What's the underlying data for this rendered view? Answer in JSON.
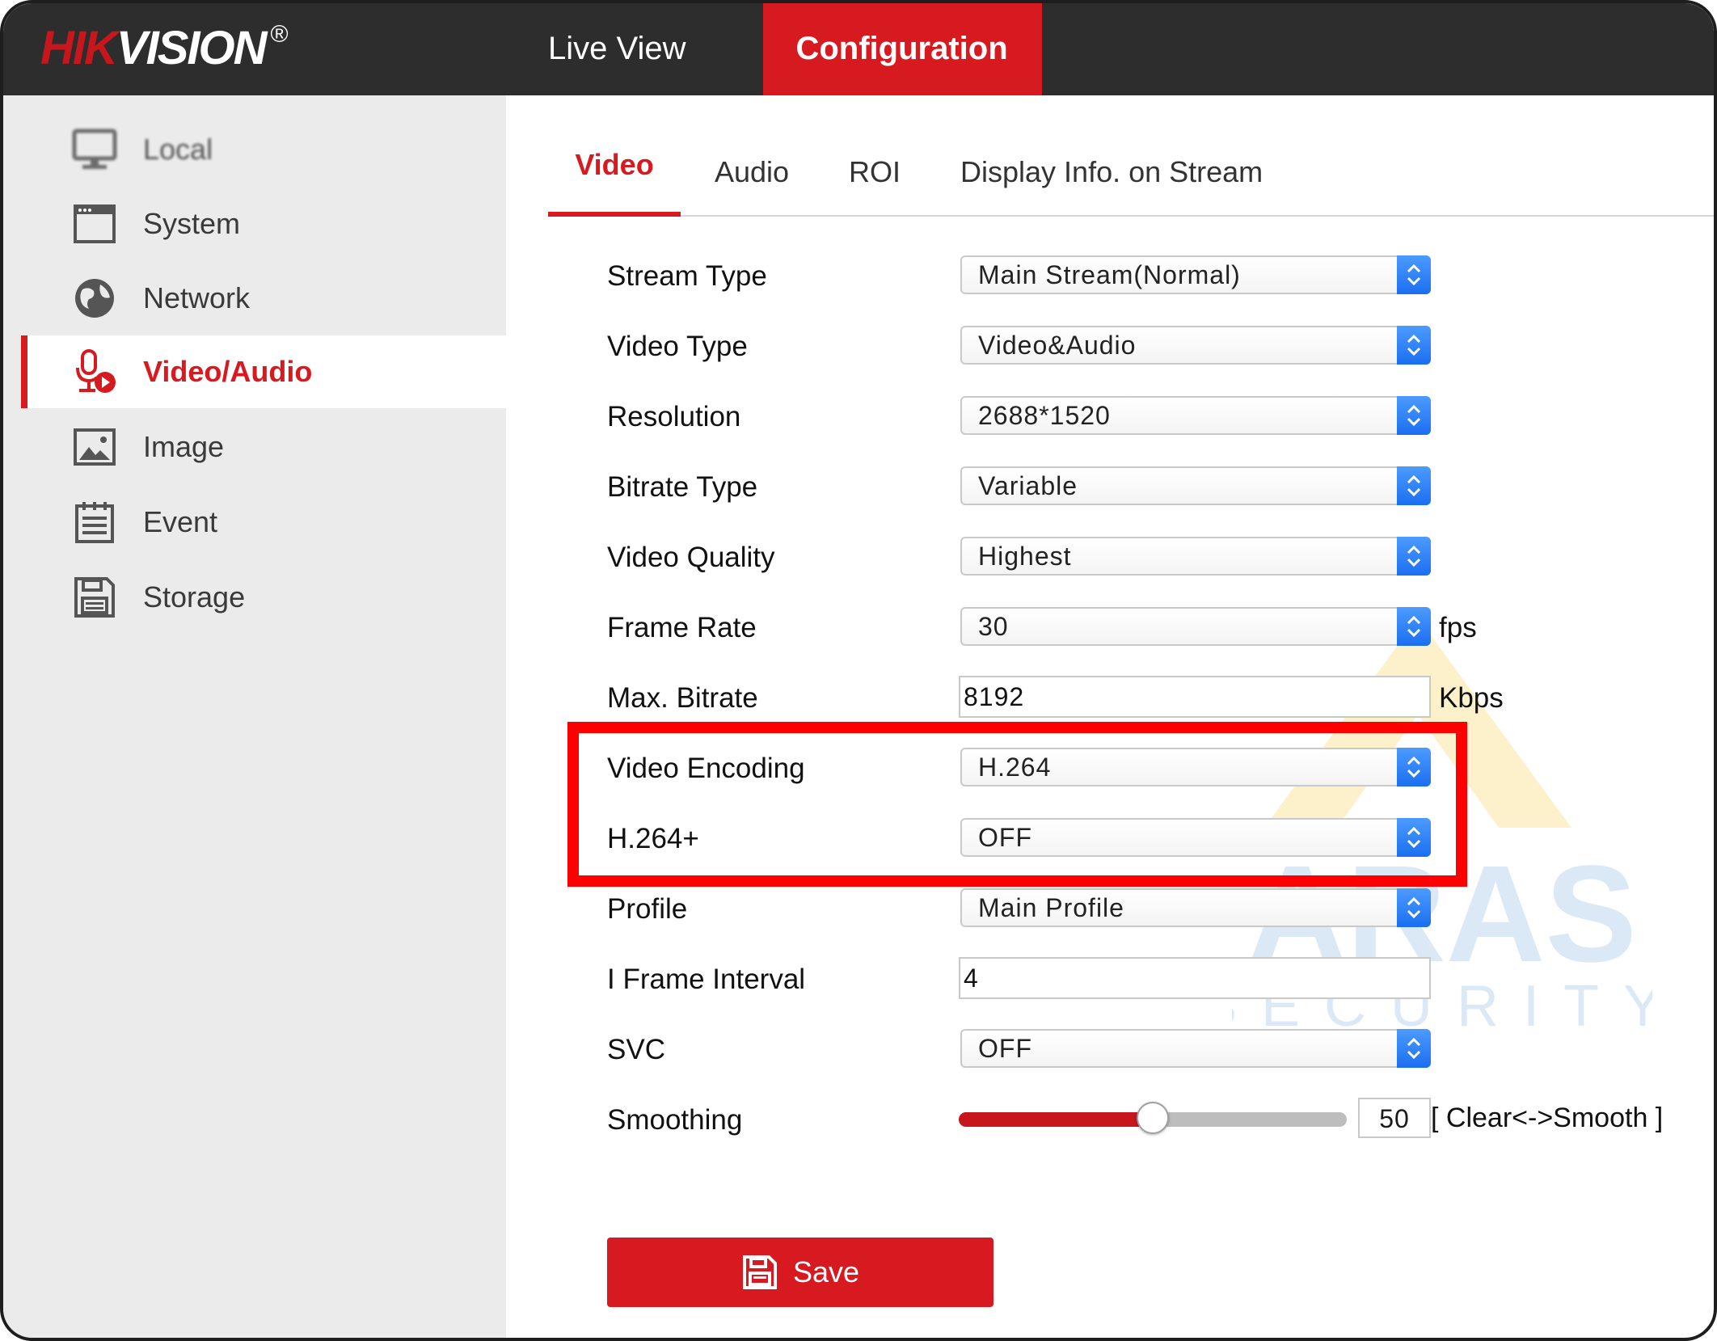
{
  "brand": {
    "logo_part1": "HIK",
    "logo_part2": "VISION",
    "logo_mark": "®"
  },
  "topnav": {
    "live_view": "Live View",
    "configuration": "Configuration"
  },
  "sidebar": {
    "items": [
      {
        "label": "Local",
        "icon": "monitor-icon"
      },
      {
        "label": "System",
        "icon": "window-icon"
      },
      {
        "label": "Network",
        "icon": "globe-icon"
      },
      {
        "label": "Video/Audio",
        "icon": "microphone-play-icon",
        "active": true
      },
      {
        "label": "Image",
        "icon": "picture-icon"
      },
      {
        "label": "Event",
        "icon": "calendar-list-icon"
      },
      {
        "label": "Storage",
        "icon": "floppy-disk-icon"
      }
    ]
  },
  "tabs": [
    {
      "label": "Video",
      "active": true
    },
    {
      "label": "Audio"
    },
    {
      "label": "ROI"
    },
    {
      "label": "Display Info. on Stream"
    }
  ],
  "form": {
    "stream_type": {
      "label": "Stream Type",
      "value": "Main Stream(Normal)"
    },
    "video_type": {
      "label": "Video Type",
      "value": "Video&Audio"
    },
    "resolution": {
      "label": "Resolution",
      "value": "2688*1520"
    },
    "bitrate_type": {
      "label": "Bitrate Type",
      "value": "Variable"
    },
    "video_quality": {
      "label": "Video Quality",
      "value": "Highest"
    },
    "frame_rate": {
      "label": "Frame Rate",
      "value": "30",
      "unit": "fps"
    },
    "max_bitrate": {
      "label": "Max. Bitrate",
      "value": "8192",
      "unit": "Kbps"
    },
    "video_encoding": {
      "label": "Video Encoding",
      "value": "H.264"
    },
    "h264_plus": {
      "label": "H.264+",
      "value": "OFF"
    },
    "profile": {
      "label": "Profile",
      "value": "Main Profile"
    },
    "i_frame_interval": {
      "label": "I Frame Interval",
      "value": "4"
    },
    "svc": {
      "label": "SVC",
      "value": "OFF"
    },
    "smoothing": {
      "label": "Smoothing",
      "value": "50",
      "value_fraction": 0.5,
      "hint": "[ Clear<->Smooth ]"
    }
  },
  "save": {
    "label": "Save"
  },
  "watermark": {
    "line1": "ARAS",
    "line2": "SECURITY"
  },
  "colors": {
    "accent": "#d71920",
    "topbar": "#2d2d2d",
    "sidebar": "#ebebeb",
    "select_arrow": "#2a7cf6",
    "highlight": "#ff0000"
  }
}
